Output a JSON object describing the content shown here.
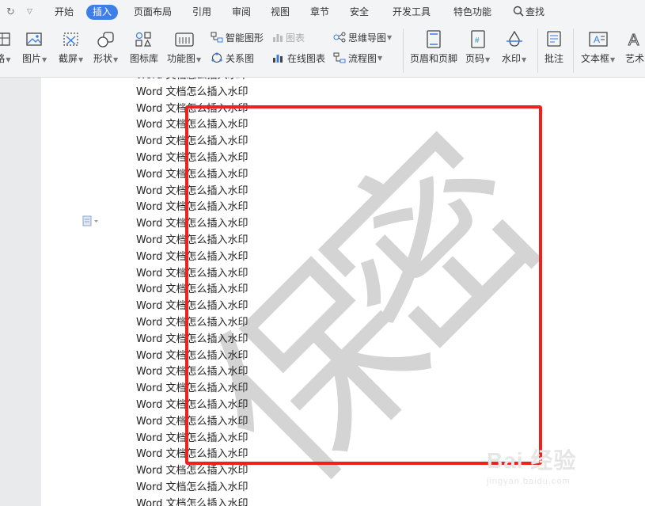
{
  "menubar": {
    "items": [
      {
        "label": "开始",
        "active": false
      },
      {
        "label": "插入",
        "active": true
      },
      {
        "label": "页面布局",
        "active": false
      },
      {
        "label": "引用",
        "active": false
      },
      {
        "label": "审阅",
        "active": false
      },
      {
        "label": "视图",
        "active": false
      },
      {
        "label": "章节",
        "active": false
      },
      {
        "label": "安全",
        "active": false
      },
      {
        "label": "开发工具",
        "active": false
      },
      {
        "label": "特色功能",
        "active": false
      }
    ],
    "search_label": "查找"
  },
  "ribbon": {
    "table": "格",
    "picture": "图片",
    "screenshot": "截屏",
    "shapes": "形状",
    "icons": "图标库",
    "function_chart": "功能图",
    "smart_art": "智能图形",
    "relation_chart": "关系图",
    "chart": "图表",
    "online_chart": "在线图表",
    "mind_map": "思维导图",
    "flowchart": "流程图",
    "header_footer": "页眉和页脚",
    "page_number": "页码",
    "watermark": "水印",
    "comment": "批注",
    "textbox": "文本框",
    "art_text": "艺术"
  },
  "document": {
    "lines": [
      "Word 文档怎么插入水印",
      "Word 文档怎么插入水印",
      "Word 文档怎么插入水印",
      "Word 文档怎么插入水印",
      "Word 文档怎么插入水印",
      "Word 文档怎么插入水印",
      "Word 文档怎么插入水印",
      "Word 文档怎么插入水印",
      "Word 文档怎么插入水印",
      "Word 文档怎么插入水印",
      "Word 文档怎么插入水印",
      "Word 文档怎么插入水印",
      "Word 文档怎么插入水印",
      "Word 文档怎么插入水印",
      "Word 文档怎么插入水印",
      "Word 文档怎么插入水印",
      "Word 文档怎么插入水印",
      "Word 文档怎么插入水印",
      "Word 文档怎么插入水印",
      "Word 文档怎么插入水印",
      "Word 文档怎么插入水印",
      "Word 文档怎么插入水印",
      "Word 文档怎么插入水印",
      "Word 文档怎么插入水印",
      "Word 文档怎么插入水印",
      "Word 文档怎么插入水印",
      "Word 文档怎么插入水印"
    ],
    "watermark_chars": [
      "保",
      "密"
    ],
    "highlight_color": "#f0201c"
  },
  "branding": {
    "logo_text": "Bai 经验",
    "logo_url": "jingyan.baidu.com"
  }
}
